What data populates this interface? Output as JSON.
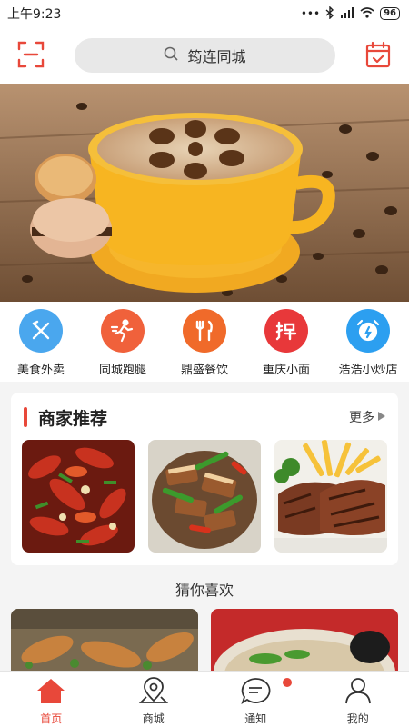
{
  "status": {
    "time": "上午9:23",
    "battery": "96"
  },
  "search": {
    "placeholder": "筠连同城"
  },
  "categories": [
    {
      "label": "美食外卖",
      "icon": "fork-knife-icon",
      "color": "#4aa7ee"
    },
    {
      "label": "同城跑腿",
      "icon": "runner-icon",
      "color": "#f0613b"
    },
    {
      "label": "鼎盛餐饮",
      "icon": "utensils-icon",
      "color": "#f06a2a"
    },
    {
      "label": "重庆小面",
      "icon": "grab-icon",
      "color": "#e8383a"
    },
    {
      "label": "浩浩小炒店",
      "icon": "alarm-clock-icon",
      "color": "#2c9ff0"
    }
  ],
  "merchant": {
    "title": "商家推荐",
    "more": "更多"
  },
  "guess": {
    "title": "猜你喜欢"
  },
  "tabs": [
    {
      "label": "首页",
      "icon": "home-icon"
    },
    {
      "label": "商城",
      "icon": "map-pin-icon"
    },
    {
      "label": "通知",
      "icon": "chat-bubble-icon"
    },
    {
      "label": "我的",
      "icon": "user-icon"
    }
  ],
  "colors": {
    "accent": "#e8483a"
  }
}
